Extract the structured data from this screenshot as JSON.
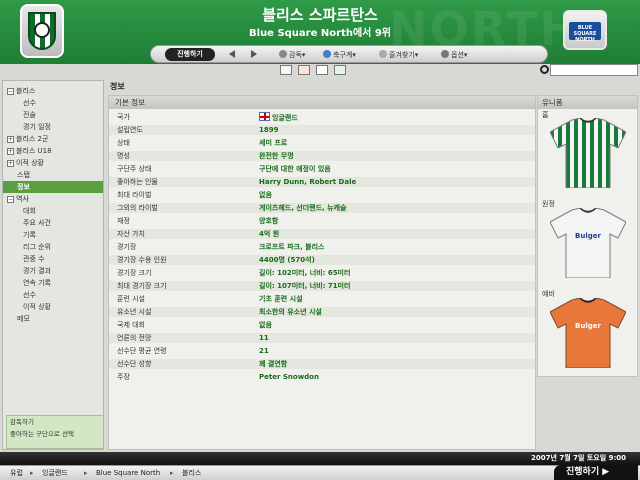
{
  "header": {
    "club_name": "블리스 스파르탄스",
    "subtitle": "Blue Square North에서 9위",
    "watermark": "NORTH",
    "league_badge_text": "BLUE SQUARE NORTH"
  },
  "nav": {
    "continue": "진행하기",
    "back_icon": "arrow-left-icon",
    "forward_icon": "arrow-right-icon",
    "manager": "감독",
    "football": "축구계",
    "bookmarks": "즐겨찾기",
    "options": "옵션"
  },
  "sidebar": {
    "items": [
      {
        "label": "블리스",
        "pm": "−"
      },
      {
        "label": "선수"
      },
      {
        "label": "전술"
      },
      {
        "label": "경기 일정"
      },
      {
        "label": "블리스 2군",
        "pm": "+"
      },
      {
        "label": "블리스 U18",
        "pm": "+"
      },
      {
        "label": "이적 상황",
        "pm": "+"
      },
      {
        "label": "스탭"
      },
      {
        "label": "정보"
      },
      {
        "label": "역사",
        "pm": "−"
      },
      {
        "label": "대회"
      },
      {
        "label": "주요 사건"
      },
      {
        "label": "기록"
      },
      {
        "label": "리그 순위"
      },
      {
        "label": "관중 수"
      },
      {
        "label": "경기 결과"
      },
      {
        "label": "연속 기록"
      },
      {
        "label": "선수"
      },
      {
        "label": "이적 상황"
      },
      {
        "label": "메모"
      }
    ],
    "tips": [
      "감독하기",
      "좋아하는 구단으로 선택"
    ]
  },
  "main": {
    "title": "정보",
    "panel_header": "기본 정보",
    "rows": [
      {
        "label": "국가",
        "value": "잉글랜드"
      },
      {
        "label": "설립연도",
        "value": "1899"
      },
      {
        "label": "상태",
        "value": "세미 프로"
      },
      {
        "label": "명성",
        "value": "완전한 무명"
      },
      {
        "label": "구단주 상태",
        "value": "구단에 대한 애정이 있음"
      },
      {
        "label": "좋아하는 인물",
        "value": "Harry Dunn, Robert Dale"
      },
      {
        "label": "최대 라이벌",
        "value": "없음"
      },
      {
        "label": "그외의 라이벌",
        "value": "게이츠헤드, 선더랜드, 뉴캐슬"
      },
      {
        "label": "재정",
        "value": "양호함"
      },
      {
        "label": "자산 가치",
        "value": "4억 원"
      },
      {
        "label": "경기장",
        "value": "크로프트 파크, 블리스"
      },
      {
        "label": "경기장 수용 인원",
        "value": "4400명 (570석)"
      },
      {
        "label": "경기장 크기",
        "value": "길이: 102미터, 너비: 65미터"
      },
      {
        "label": "최대 경기장 크기",
        "value": "길이: 107미터, 너비: 71미터"
      },
      {
        "label": "훈련 시설",
        "value": "기초 훈련 시설"
      },
      {
        "label": "유소년 시설",
        "value": "최소한의 유소년 시설"
      },
      {
        "label": "국제 대회",
        "value": "없음"
      },
      {
        "label": "언론의 전망",
        "value": "11"
      },
      {
        "label": "선수단 평균 연령",
        "value": "21"
      },
      {
        "label": "선수단 성향",
        "value": "꽤 결연함"
      },
      {
        "label": "주장",
        "value": "Peter Snowdon"
      }
    ]
  },
  "kits": {
    "header": "유니폼",
    "home": "홈",
    "away": "원정",
    "third": "예비",
    "sponsor": "Bulger"
  },
  "datebar": {
    "date": "2007년 7월 7일 토요일 9:00"
  },
  "breadcrumb": [
    "유럽",
    "잉글랜드",
    "Blue Square North",
    "블리스"
  ],
  "bottom": {
    "continue": "진행하기"
  }
}
